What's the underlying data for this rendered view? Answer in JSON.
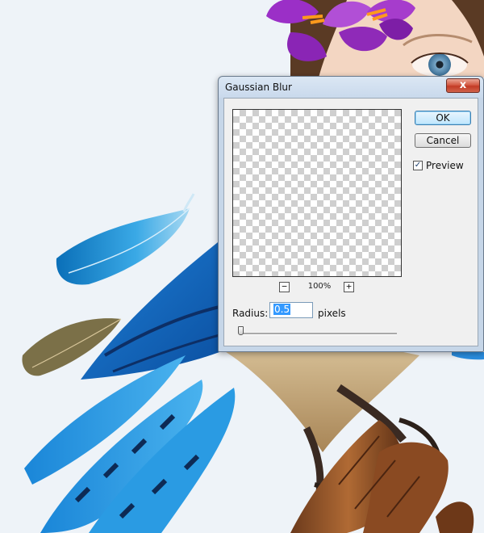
{
  "dialog": {
    "title": "Gaussian Blur",
    "close_symbol": "x",
    "ok_label": "OK",
    "cancel_label": "Cancel",
    "preview_label": "Preview",
    "preview_checked": true,
    "zoom_out_symbol": "−",
    "zoom_in_symbol": "+",
    "zoom_level": "100%",
    "radius_label": "Radius:",
    "radius_value": "0.5",
    "units_label": "pixels",
    "radius_slider_fraction": 0.01
  },
  "colors": {
    "close_button": "#c8422d",
    "ok_button_accent": "#3c7fb1",
    "selection": "#3399ff"
  },
  "icons": {
    "checkbox_mark": "✓"
  }
}
